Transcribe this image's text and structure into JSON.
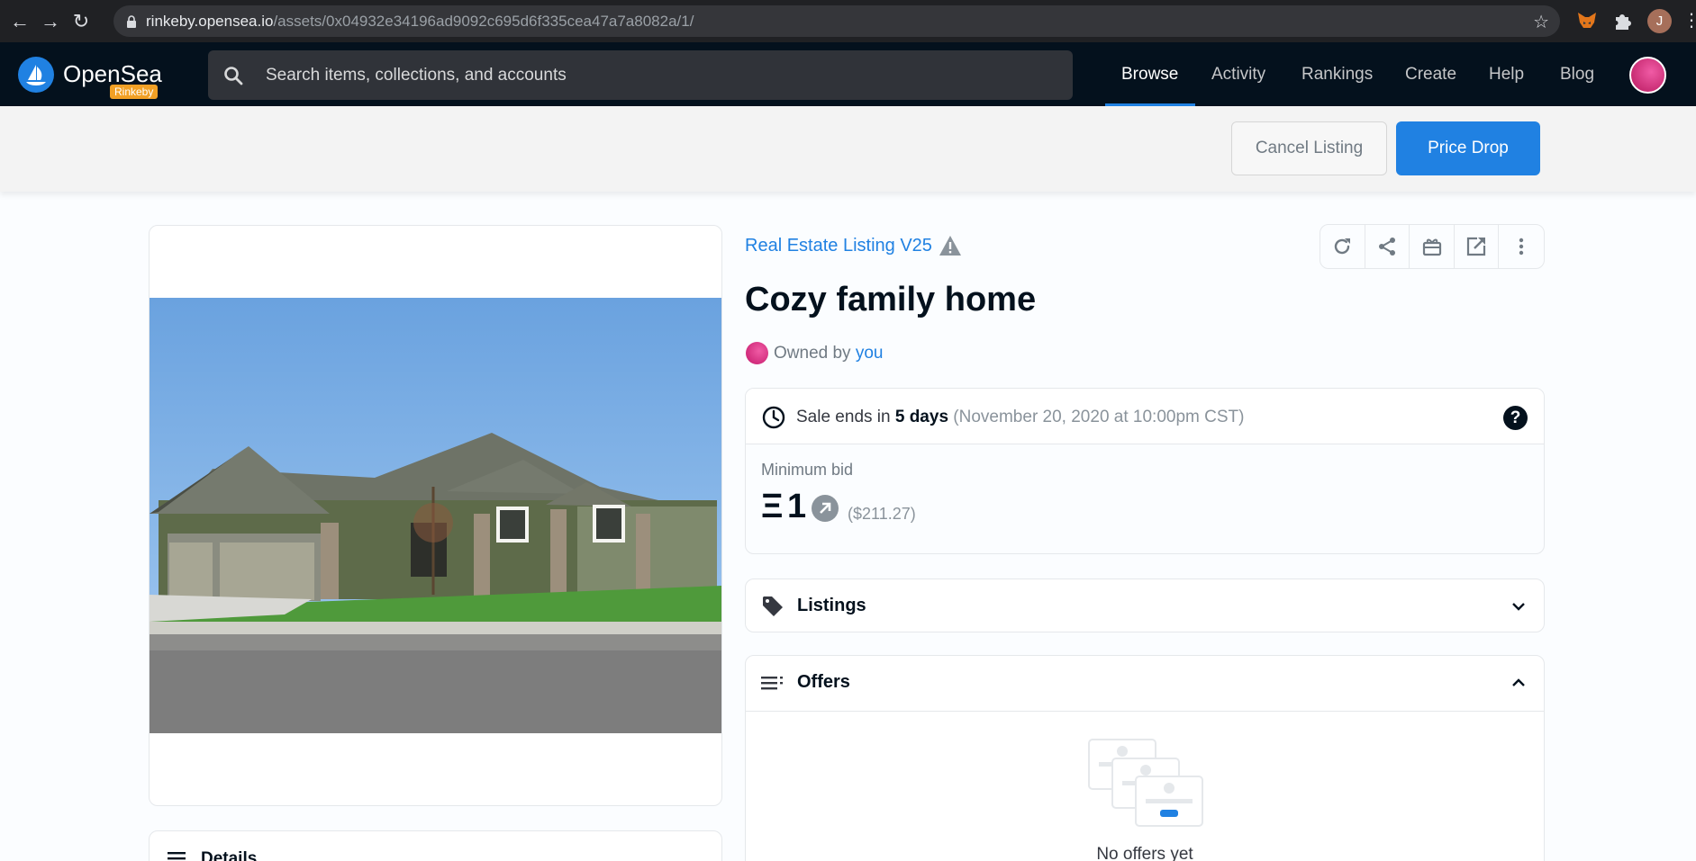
{
  "browser": {
    "url_host": "rinkeby.opensea.io",
    "url_path": "/assets/0x04932e34196ad9092c695d6f335cea47a7a8082a/1/",
    "profile_initial": "J"
  },
  "header": {
    "logo_text": "OpenSea",
    "network_badge": "Rinkeby",
    "search_placeholder": "Search items, collections, and accounts",
    "nav": [
      "Browse",
      "Activity",
      "Rankings",
      "Create",
      "Help",
      "Blog"
    ],
    "active_nav": "Browse"
  },
  "actions": {
    "cancel_label": "Cancel Listing",
    "price_drop_label": "Price Drop"
  },
  "asset": {
    "collection": "Real Estate Listing V25",
    "title": "Cozy family home",
    "owned_by_label": "Owned by",
    "owner": "you"
  },
  "sale": {
    "ends_prefix": "Sale ends in",
    "ends_in": "5 days",
    "ends_date": "(November 20, 2020 at 10:00pm CST)",
    "min_bid_label": "Minimum bid",
    "currency_symbol": "Ξ",
    "amount": "1",
    "usd": "($211.27)"
  },
  "sections": {
    "listings_label": "Listings",
    "offers_label": "Offers",
    "no_offers": "No offers yet",
    "details_label": "Details"
  },
  "icons": {
    "warning": "warning-icon",
    "refresh": "refresh-icon",
    "share": "share-icon",
    "gift": "gift-icon",
    "external": "external-link-icon",
    "more": "more-vertical-icon"
  },
  "colors": {
    "accent": "#2081e2",
    "header_bg": "#04111d",
    "badge": "#f2a025"
  }
}
